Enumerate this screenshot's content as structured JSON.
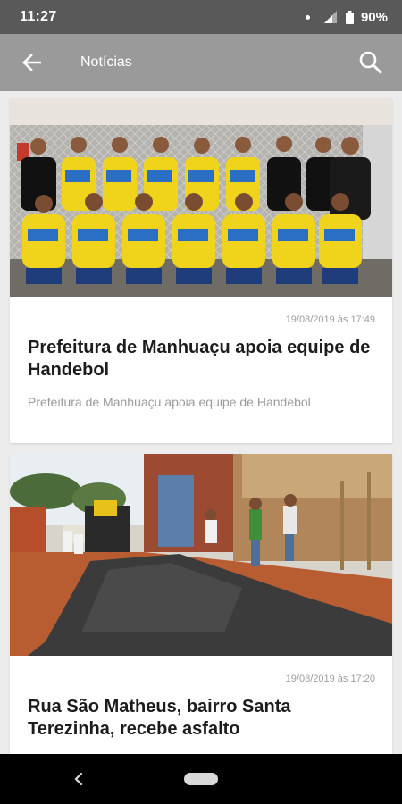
{
  "status_bar": {
    "time": "11:27",
    "battery": "90%"
  },
  "app_bar": {
    "title": "Notícias"
  },
  "news": [
    {
      "date": "19/08/2019 às 17:49",
      "title": "Prefeitura de Manhuaçu apoia equipe de Handebol",
      "summary": "Prefeitura de Manhuaçu apoia equipe de Handebol"
    },
    {
      "date": "19/08/2019 às 17:20",
      "title": "Rua São Matheus, bairro Santa Terezinha, recebe asfalto"
    }
  ],
  "colors": {
    "status_bar": "#595959",
    "app_bar": "#9a9a9a",
    "background": "#ececec",
    "title_text": "#1c1c1c",
    "muted_text": "#9e9e9e"
  },
  "icons": [
    "back-arrow-icon",
    "search-icon",
    "signal-icon",
    "battery-icon",
    "nav-back-icon",
    "home-pill-icon"
  ]
}
